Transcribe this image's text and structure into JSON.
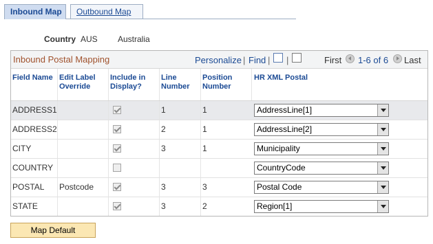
{
  "tabs": [
    {
      "label": "Inbound Map",
      "active": true
    },
    {
      "label": "Outbound Map",
      "active": false
    }
  ],
  "country": {
    "label": "Country",
    "code": "AUS",
    "name": "Australia"
  },
  "grid": {
    "title": "Inbound Postal Mapping",
    "personalize": "Personalize",
    "separator": "|",
    "find": "Find",
    "first": "First",
    "range": "1-6 of 6",
    "last": "Last",
    "columns": [
      "Field Name",
      "Edit Label Override",
      "Include in Display?",
      "Line Number",
      "Position Number",
      "HR XML Postal"
    ],
    "rows": [
      {
        "field": "ADDRESS1",
        "override": "",
        "include": true,
        "line": "1",
        "position": "1",
        "postal": "AddressLine[1]"
      },
      {
        "field": "ADDRESS2",
        "override": "",
        "include": true,
        "line": "2",
        "position": "1",
        "postal": "AddressLine[2]"
      },
      {
        "field": "CITY",
        "override": "",
        "include": true,
        "line": "3",
        "position": "1",
        "postal": "Municipality"
      },
      {
        "field": "COUNTRY",
        "override": "",
        "include": false,
        "line": "",
        "position": "",
        "postal": "CountryCode"
      },
      {
        "field": "POSTAL",
        "override": "Postcode",
        "include": true,
        "line": "3",
        "position": "3",
        "postal": "Postal Code"
      },
      {
        "field": "STATE",
        "override": "",
        "include": true,
        "line": "3",
        "position": "2",
        "postal": "Region[1]"
      }
    ]
  },
  "button": {
    "label": "Map Default"
  },
  "colors": {
    "header_text": "#1b4a94",
    "grid_title": "#a0522d",
    "button_bg": "#fbe7b3"
  }
}
